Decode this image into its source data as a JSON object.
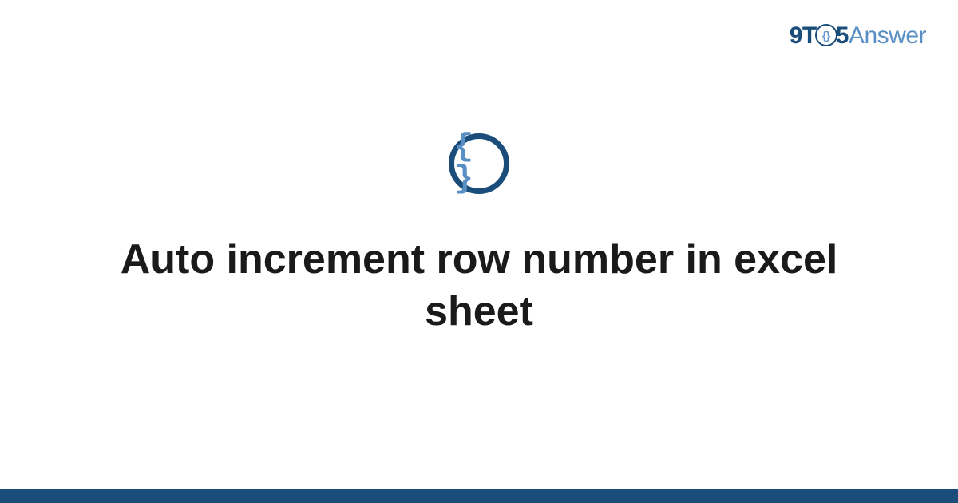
{
  "logo": {
    "part1": "9T",
    "circle_inner": "{}",
    "part2": "5",
    "part3": "Answer"
  },
  "icon": {
    "braces": "{ }"
  },
  "title": "Auto increment row number in excel sheet"
}
